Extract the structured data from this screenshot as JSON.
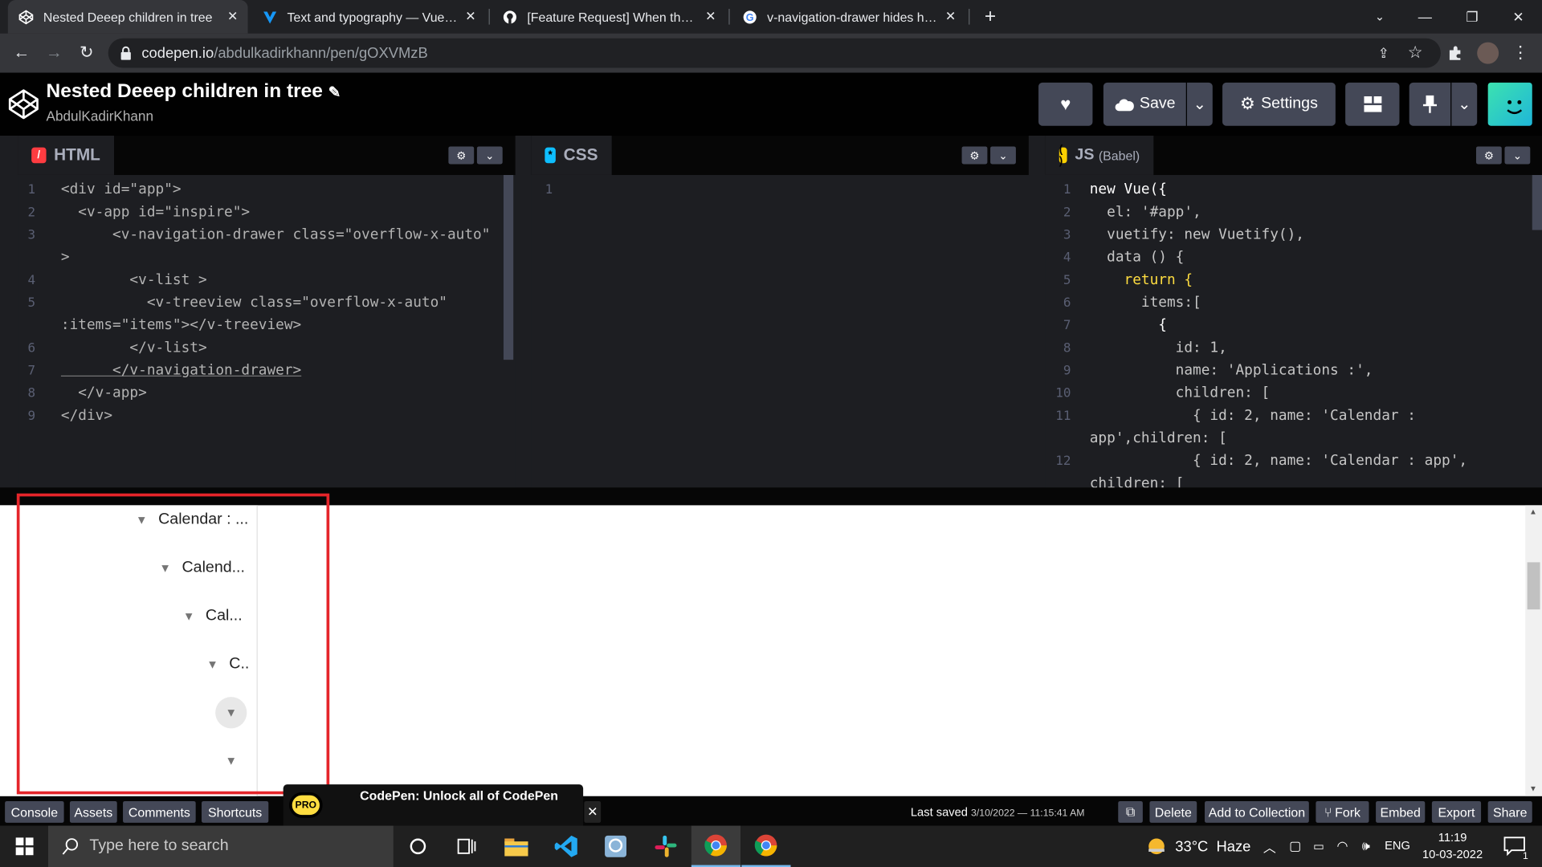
{
  "browser": {
    "tabs": [
      {
        "title": "Nested Deeep children in tree",
        "icon": "codepen-icon"
      },
      {
        "title": "Text and typography — Vuetify",
        "icon": "vuetify-icon"
      },
      {
        "title": "[Feature Request] When the cont",
        "icon": "github-icon"
      },
      {
        "title": "v-navigation-drawer hides horizo",
        "icon": "google-icon"
      }
    ],
    "url_host": "codepen.io",
    "url_path": "/abdulkadirkhann/pen/gOXVMzB"
  },
  "codepen": {
    "pen_title": "Nested Deeep children in tree",
    "author": "AbdulKadirKhann",
    "save_label": "Save",
    "settings_label": "Settings"
  },
  "editors": {
    "html": {
      "label": "HTML",
      "line_numbers": [
        "1",
        "2",
        "3",
        "",
        "4",
        "5",
        "",
        "6",
        "7",
        "8",
        "9"
      ],
      "lines": [
        "<div id=\"app\">",
        "  <v-app id=\"inspire\">",
        "      <v-navigation-drawer class=\"overflow-x-auto\"",
        ">",
        "        <v-list >",
        "          <v-treeview class=\"overflow-x-auto\"",
        ":items=\"items\"></v-treeview>",
        "        </v-list>",
        "      </v-navigation-drawer>",
        "  </v-app>",
        "</div>"
      ]
    },
    "css": {
      "label": "CSS",
      "line_numbers": [
        "1"
      ]
    },
    "js": {
      "label": "JS",
      "sublabel": "(Babel)",
      "line_numbers": [
        "1",
        "2",
        "3",
        "4",
        "5",
        "6",
        "7",
        "8",
        "9",
        "10",
        "11",
        "",
        "12",
        ""
      ],
      "lines": [
        "new Vue({",
        "  el: '#app',",
        "  vuetify: new Vuetify(),",
        "  data () {",
        "    return {",
        "      items:[",
        "        {",
        "          id: 1,",
        "          name: 'Applications :',",
        "          children: [",
        "            { id: 2, name: 'Calendar :",
        "app',children: [",
        "            { id: 2, name: 'Calendar : app',",
        "children: ["
      ]
    }
  },
  "preview": {
    "tree_nodes": [
      "Calendar : ...",
      "Calend...",
      "Cal...",
      "C..",
      "",
      ""
    ]
  },
  "bottom_bar": {
    "left_buttons": [
      "Console",
      "Assets",
      "Comments",
      "Shortcuts"
    ],
    "pro_badge": "PRO",
    "promo_text": "CodePen: Unlock all of CodePen",
    "last_saved_label": "Last saved",
    "last_saved_value": "3/10/2022 — 11:15:41 AM",
    "right_buttons": [
      "Delete",
      "Add to Collection",
      "Fork",
      "Embed",
      "Export",
      "Share"
    ]
  },
  "taskbar": {
    "search_placeholder": "Type here to search",
    "weather": "33°C  Haze",
    "language": "ENG",
    "time": "11:19",
    "date": "10-03-2022",
    "notification_count": "1"
  },
  "colors": {
    "html_logo": "#ff3c41",
    "css_logo": "#0ebeff",
    "js_logo": "#fcd000",
    "highlight_box": "#e5252a"
  }
}
